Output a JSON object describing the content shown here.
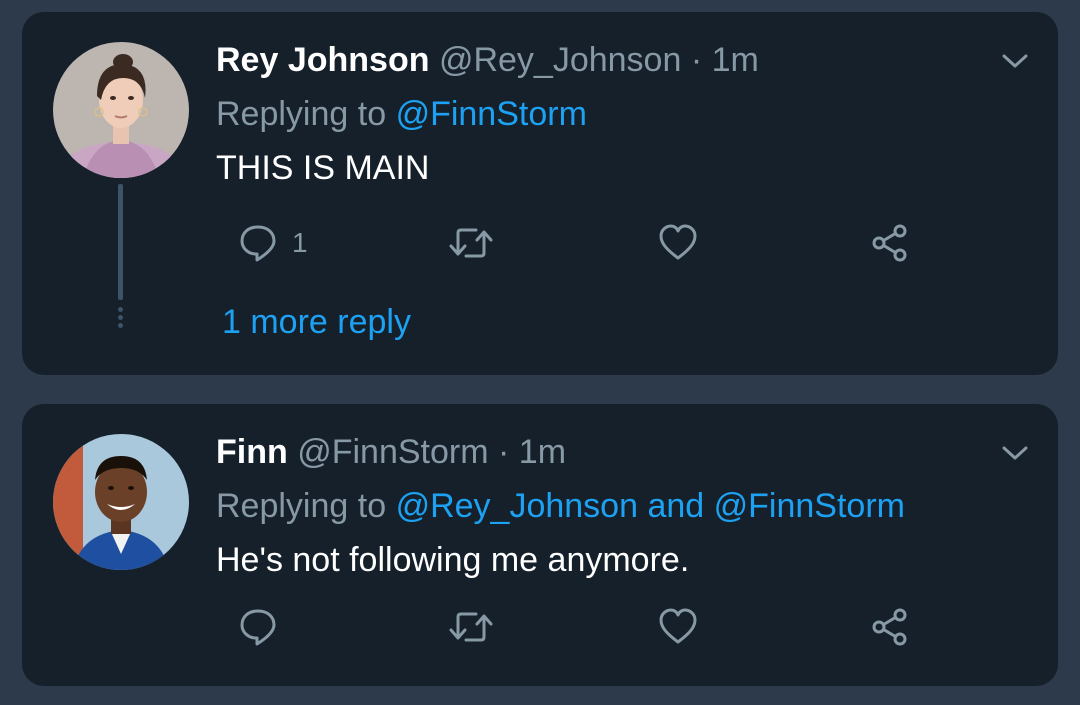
{
  "tweets": [
    {
      "name": "Rey Johnson",
      "handle": "@Rey_Johnson",
      "separator": "·",
      "time": "1m",
      "replying_prefix": "Replying to",
      "replying_to": [
        "@FinnStorm"
      ],
      "replying_joiner": "",
      "text": "THIS IS MAIN",
      "reply_count": "1",
      "more_replies": "1 more reply",
      "icons": [
        "reply-icon",
        "retweet-icon",
        "like-icon",
        "share-icon",
        "chevron-down-icon"
      ]
    },
    {
      "name": "Finn",
      "handle": "@FinnStorm",
      "separator": "·",
      "time": "1m",
      "replying_prefix": "Replying to",
      "replying_to": [
        "@Rey_Johnson",
        "@FinnStorm"
      ],
      "replying_joiner": "and",
      "text": "He's not following me anymore.",
      "reply_count": "",
      "icons": [
        "reply-icon",
        "retweet-icon",
        "like-icon",
        "share-icon",
        "chevron-down-icon"
      ]
    }
  ],
  "colors": {
    "background": "#2c3a4c",
    "card": "#15202b",
    "accent": "#1da1f2",
    "secondary_text": "#8899a6",
    "primary_text": "#ffffff"
  }
}
